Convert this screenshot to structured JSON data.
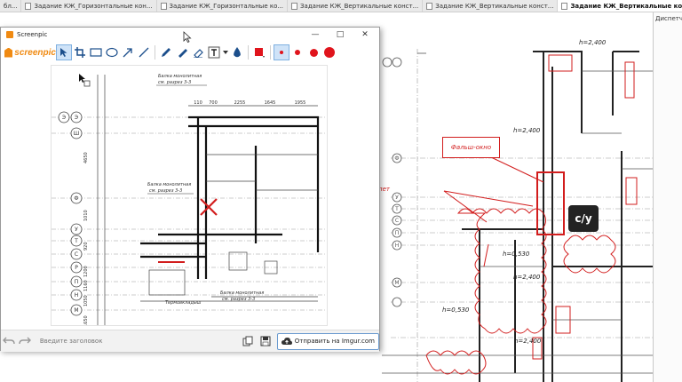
{
  "tabs": [
    {
      "label": "бл..."
    },
    {
      "label": "Задание КЖ_Горизонтальные кон..."
    },
    {
      "label": "Задание КЖ_Горизонтальные ко..."
    },
    {
      "label": "Задание КЖ_Вертикальные конст..."
    },
    {
      "label": "Задание КЖ_Вертикальные конст..."
    },
    {
      "label": "Задание КЖ_Вертикальные конс"
    }
  ],
  "side_panel": {
    "label": "Диспетче"
  },
  "drawing": {
    "falsh_label": "Фальш-окно",
    "pet_label": "пет",
    "cy_badge": "с/у",
    "heights": [
      "h=2,400",
      "h=2,400",
      "h=0,530",
      "h=2,400",
      "h=0,530",
      "h=2,400"
    ],
    "axes_right": [
      "Ф",
      "У",
      "Т",
      "С",
      "П",
      "Н",
      "М"
    ]
  },
  "screenpic": {
    "title": "Screenpic",
    "logo_text": "screenpic",
    "window_controls": [
      "—",
      "□",
      "✕"
    ],
    "tools": [
      "pointer-icon",
      "crop-icon",
      "rectangle-icon",
      "ellipse-icon",
      "arrow-icon",
      "line-icon",
      "pencil-icon",
      "marker-icon",
      "eraser-icon",
      "text-icon",
      "blur-icon",
      "color-icon",
      "dot-small",
      "dot-medium",
      "dot-large",
      "dot-xlarge"
    ],
    "colors": {
      "accent": "#f08a12",
      "red": "#e0141c",
      "selected": "#cfe3f8"
    },
    "canvas": {
      "beam_label_1a": "Балка монолитная",
      "beam_label_1b": "см. разрез 3-3",
      "beam_label_2a": "Балка монолитная",
      "beam_label_2b": "см. разрез 3-3",
      "beam_label_3a": "Балка монолитная",
      "beam_label_3b": "см. разрез 3-3",
      "thermo_label": "Термовкладыш",
      "dims_top": [
        "110",
        "700",
        "2255",
        "1645",
        "1955"
      ],
      "axes_left": [
        "Э",
        "Ш",
        "Ф",
        "У",
        "Т",
        "С",
        "Р",
        "П",
        "Н",
        "М"
      ],
      "rows": [
        "4650",
        "1010",
        "920",
        "1200",
        "1160",
        "1050",
        "1650"
      ]
    },
    "title_placeholder": "Введите заголовок",
    "upload_label": "Отправить на Imgur.com"
  }
}
